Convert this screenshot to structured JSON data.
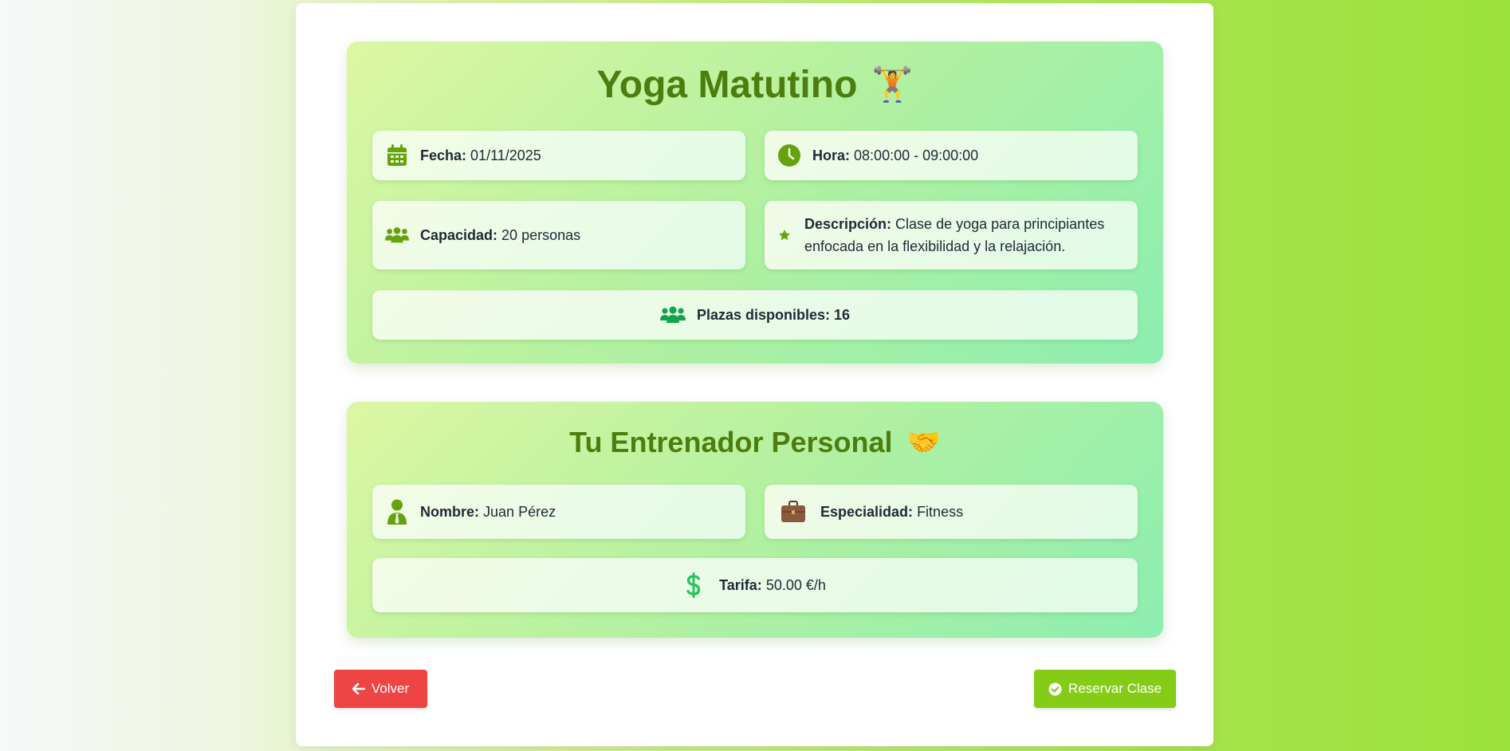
{
  "class_section": {
    "title": "Yoga Matutino",
    "title_emoji": "🏋️",
    "date_label": "Fecha:",
    "date_value": "01/11/2025",
    "time_label": "Hora:",
    "time_value": "08:00:00 - 09:00:00",
    "capacity_label": "Capacidad:",
    "capacity_value": "20 personas",
    "description_label": "Descripción:",
    "description_value": "Clase de yoga para principiantes enfocada en la flexibilidad y la relajación.",
    "spots_label": "Plazas disponibles: 16"
  },
  "trainer_section": {
    "title": "Tu Entrenador Personal",
    "title_emoji": "🤝",
    "name_label": "Nombre:",
    "name_value": "Juan Pérez",
    "specialty_label": "Especialidad:",
    "specialty_value": "Fitness",
    "rate_label": "Tarifa:",
    "rate_value": "50.00 €/h"
  },
  "buttons": {
    "back_label": "Volver",
    "book_label": "Reservar Clase"
  },
  "icons": {
    "date": "calendar-icon",
    "time": "clock-icon",
    "capacity": "users-icon",
    "description": "star-icon",
    "spots": "users-icon",
    "name": "user-tie-icon",
    "specialty": "briefcase-icon",
    "rate": "dollar-icon",
    "back": "arrow-left-icon",
    "book": "check-circle-icon"
  },
  "colors": {
    "accent_green": "#4d7c0f",
    "icon_green": "#65a30d",
    "spots_icon": "#16a34a",
    "dollar_icon": "#22c55e",
    "back_button": "#ef4444",
    "book_button": "#84cc16"
  }
}
